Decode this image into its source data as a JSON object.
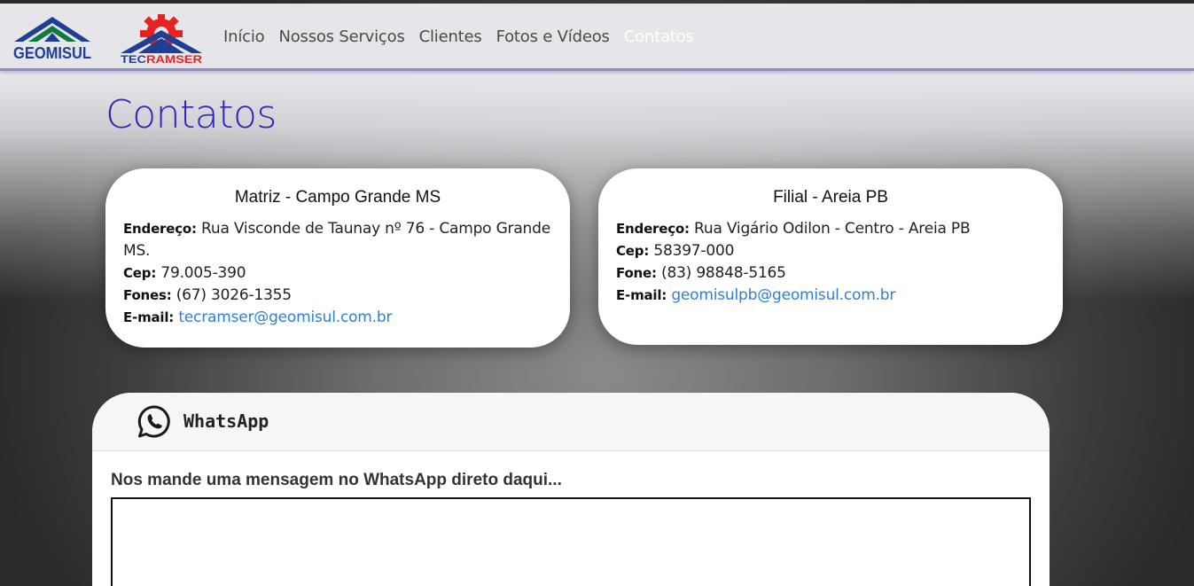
{
  "navbar": {
    "logos": {
      "geomisul": "GEOMISUL",
      "tecramser": "TECRAMSER"
    },
    "links": [
      {
        "label": "Início",
        "active": false
      },
      {
        "label": "Nossos Serviços",
        "active": false
      },
      {
        "label": "Clientes",
        "active": false
      },
      {
        "label": "Fotos e Vídeos",
        "active": false
      },
      {
        "label": "Contatos",
        "active": true
      }
    ]
  },
  "page": {
    "title": "Contatos"
  },
  "cards": {
    "matriz": {
      "title": "Matriz - Campo Grande MS",
      "address_label": "Endereço:",
      "address": "Rua Visconde de Taunay nº 76 - Campo Grande MS.",
      "cep_label": "Cep:",
      "cep": "79.005-390",
      "phone_label": "Fones:",
      "phone": "(67) 3026-1355",
      "email_label": "E-mail:",
      "email": "tecramser@geomisul.com.br"
    },
    "filial": {
      "title": "Filial - Areia PB",
      "address_label": "Endereço:",
      "address": "Rua Vigário Odilon - Centro - Areia PB",
      "cep_label": "Cep:",
      "cep": "58397-000",
      "phone_label": "Fone:",
      "phone": "(83) 98848-5165",
      "email_label": "E-mail:",
      "email": "geomisulpb@geomisul.com.br"
    }
  },
  "whatsapp": {
    "icon": "whatsapp-icon",
    "title": "WhatsApp",
    "prompt": "Nos mande uma mensagem no WhatsApp direto daqui...",
    "message_value": ""
  },
  "colors": {
    "title_blue": "#2e24b8",
    "link_blue": "#2e7fd8",
    "logo_blue": "#1f3f95",
    "logo_green": "#0f7a3c",
    "tecramser_red": "#e52421"
  }
}
